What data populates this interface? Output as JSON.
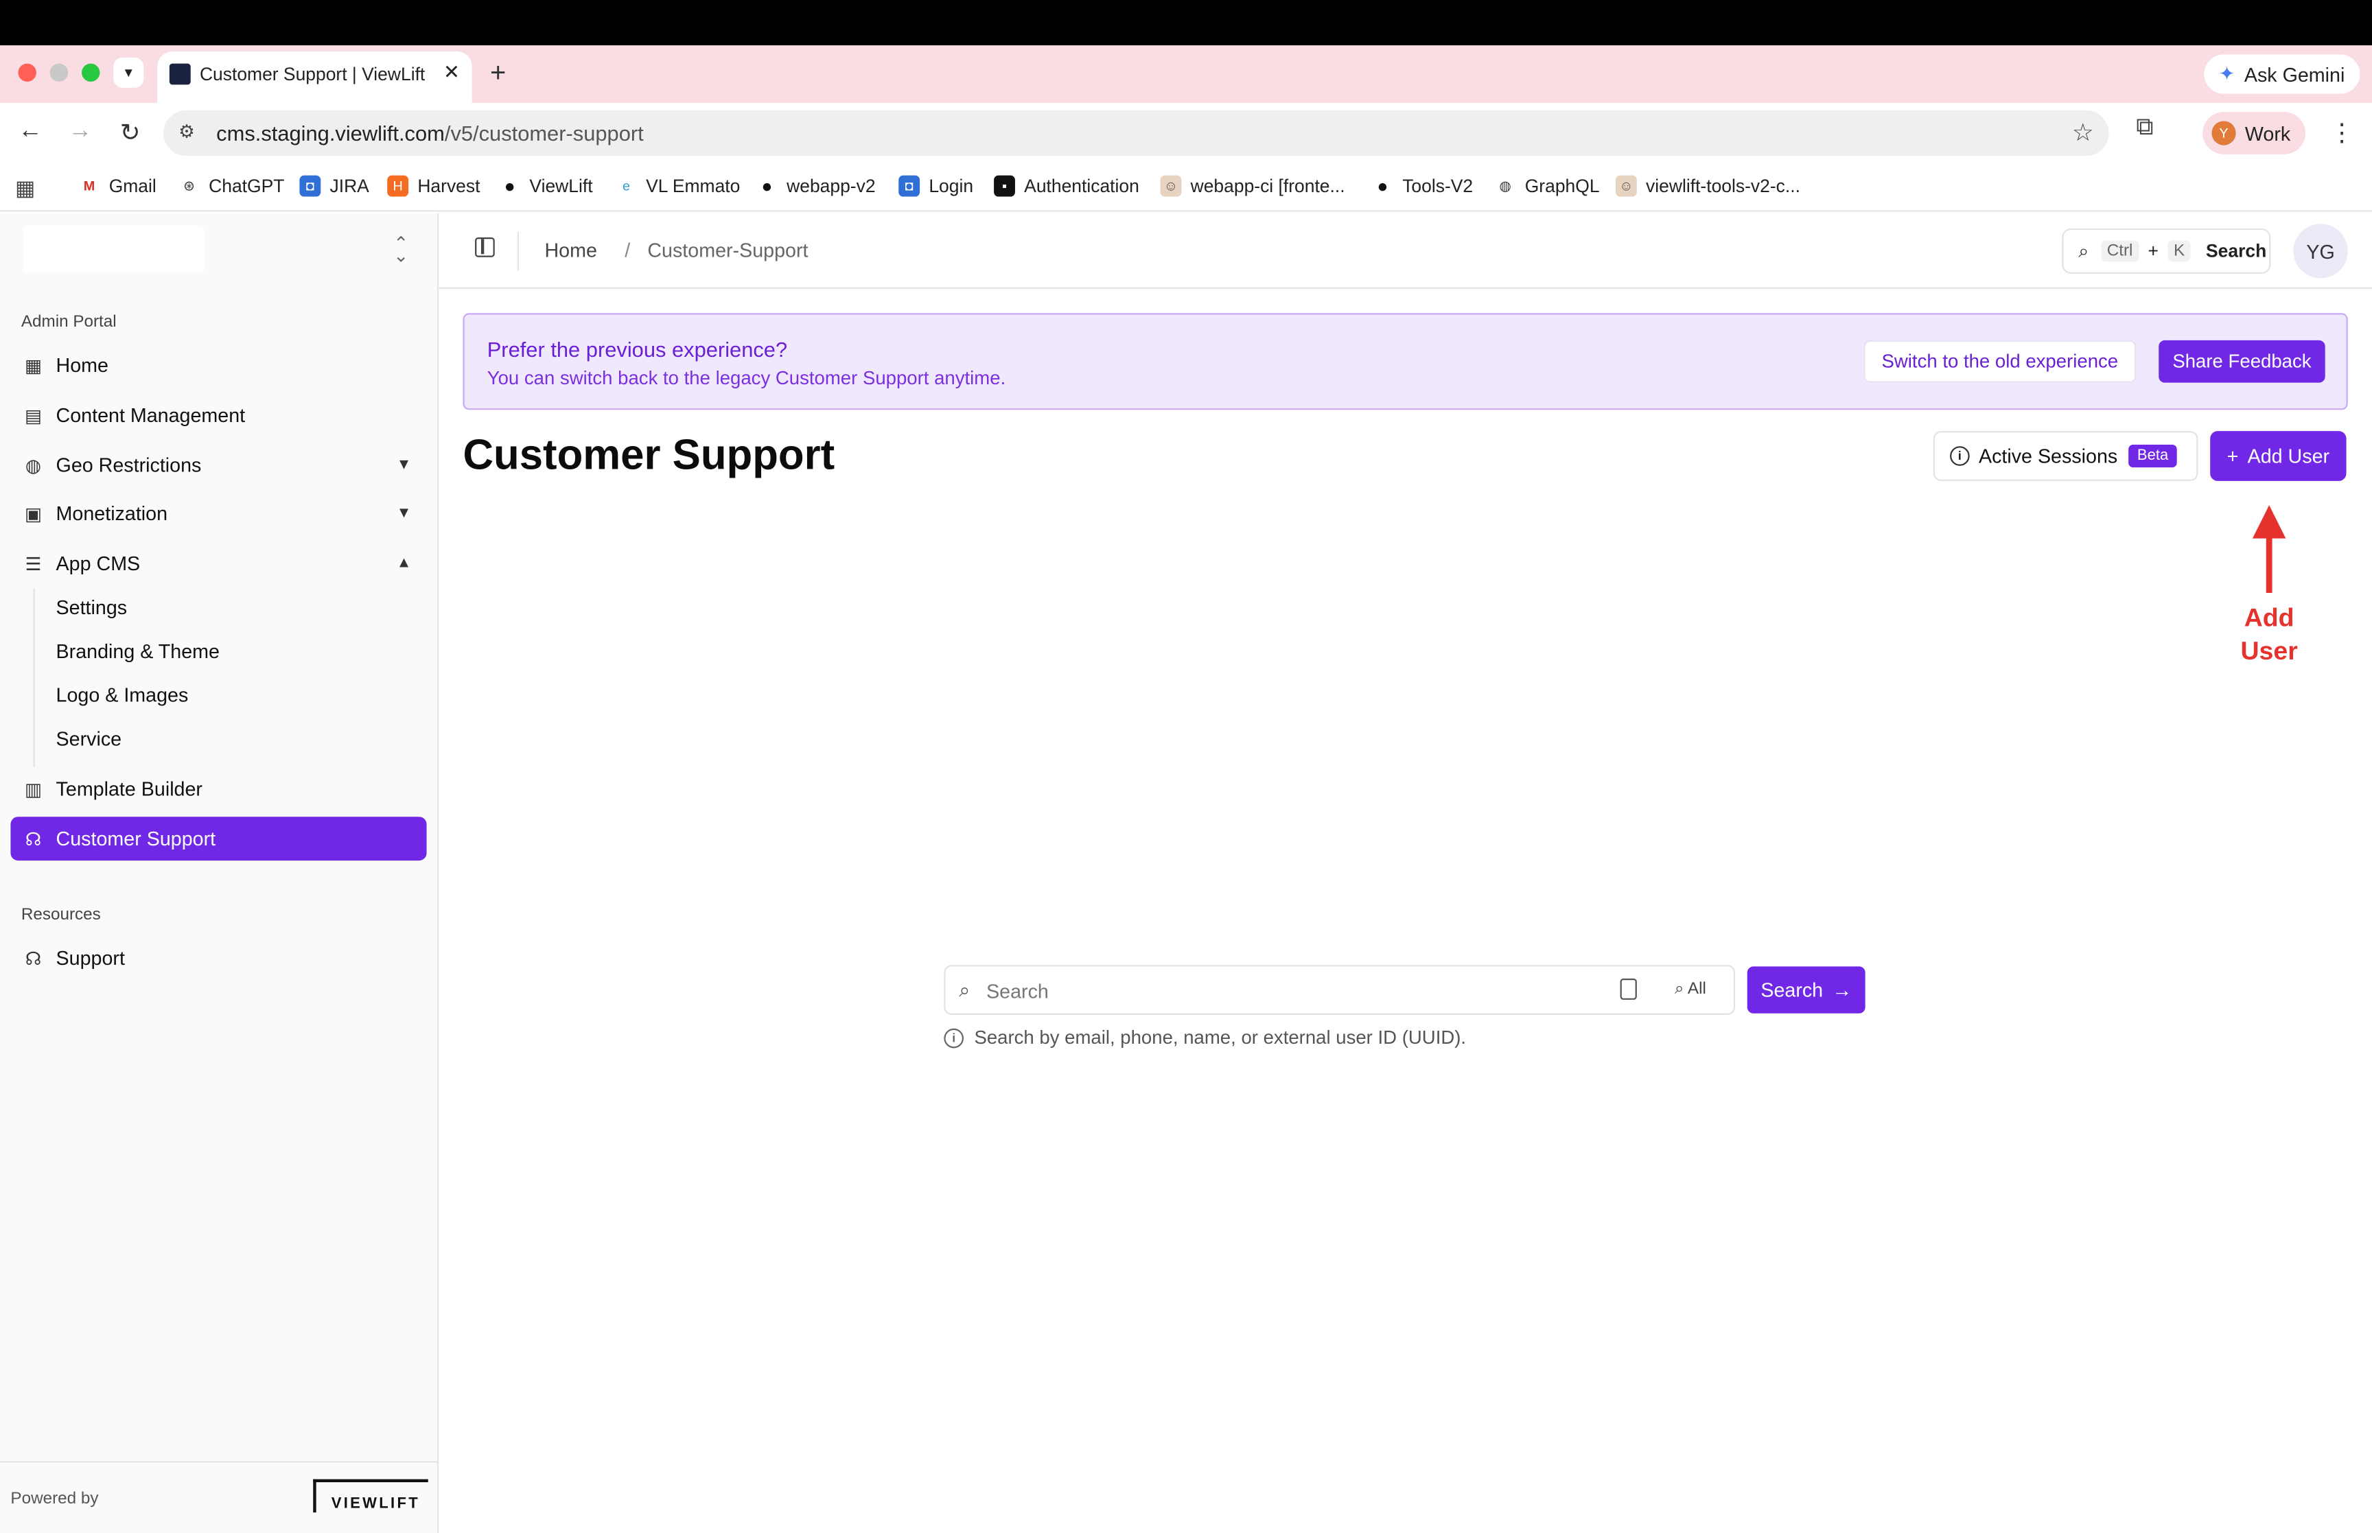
{
  "browser": {
    "tab_title": "Customer Support | ViewLift CMS",
    "new_tab_symbol": "+",
    "ask_gemini": "Ask Gemini",
    "url_host": "cms.staging.viewlift.com",
    "url_path": "/v5/customer-support",
    "profile_initial": "Y",
    "profile_label": "Work",
    "bookmarks": [
      "Gmail",
      "ChatGPT",
      "JIRA",
      "Harvest",
      "ViewLift",
      "VL Emmato",
      "webapp-v2",
      "Login",
      "Authentication",
      "webapp-ci [fronte...",
      "Tools-V2",
      "GraphQL",
      "viewlift-tools-v2-c..."
    ]
  },
  "sidebar": {
    "section_admin": "Admin Portal",
    "items": [
      {
        "label": "Home",
        "icon": "dashboard-icon"
      },
      {
        "label": "Content Management",
        "icon": "film-icon"
      },
      {
        "label": "Geo Restrictions",
        "icon": "globe-icon"
      },
      {
        "label": "Monetization",
        "icon": "wallet-icon"
      },
      {
        "label": "App CMS",
        "icon": "sliders-icon"
      },
      {
        "label": "Template Builder",
        "icon": "layout-icon"
      },
      {
        "label": "Customer Support",
        "icon": "headset-icon"
      }
    ],
    "sub_items": [
      "Settings",
      "Branding & Theme",
      "Logo & Images",
      "Service"
    ],
    "section_resources": "Resources",
    "support": "Support",
    "powered_by": "Powered by",
    "logo_text": "VIEWLIFT"
  },
  "header": {
    "crumb_home": "Home",
    "crumb_sep": "/",
    "crumb_current": "Customer-Support",
    "search_key1": "Ctrl",
    "search_plus": "+",
    "search_key2": "K",
    "search_label": "Search",
    "avatar": "YG"
  },
  "banner": {
    "title": "Prefer the previous experience?",
    "subtitle": "You can switch back to the legacy Customer Support anytime.",
    "switch_label": "Switch to the old experience",
    "feedback_label": "Share Feedback"
  },
  "main": {
    "title": "Customer Support",
    "active_sessions": "Active Sessions",
    "beta": "Beta",
    "add_user": "Add User"
  },
  "annotation": {
    "line1": "Add",
    "line2": "User",
    "color": "#e5322c"
  },
  "search": {
    "placeholder": "Search",
    "scope": "All",
    "button": "Search",
    "hint": "Search by email, phone, name, or external user ID (UUID)."
  },
  "colors": {
    "accent": "#7128e6",
    "banner_bg": "#f0e9fd"
  }
}
